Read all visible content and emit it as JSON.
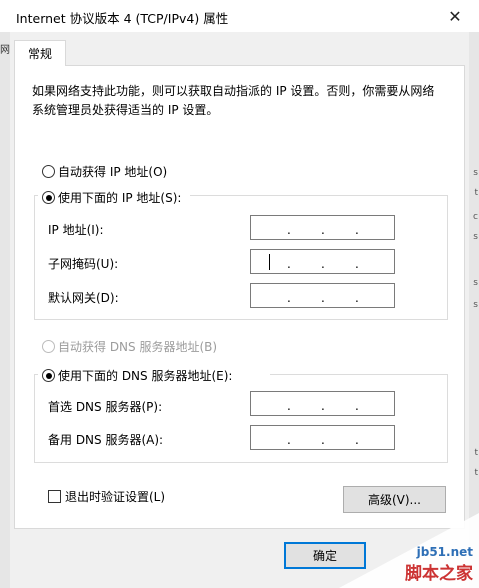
{
  "window": {
    "title": "Internet 协议版本 4 (TCP/IPv4) 属性",
    "close_glyph": "✕"
  },
  "background": {
    "left_text": "网",
    "right_marks": [
      "s",
      "t",
      "c",
      "s",
      "s",
      "s",
      "t",
      "t"
    ]
  },
  "tabs": [
    {
      "label": "常规"
    }
  ],
  "description": "如果网络支持此功能，则可以获取自动指派的 IP 设置。否则，你需要从网络系统管理员处获得适当的 IP 设置。",
  "ip_section": {
    "auto_label": "自动获得 IP 地址(O)",
    "auto_selected": false,
    "manual_label": "使用下面的 IP 地址(S):",
    "manual_selected": true,
    "fields": [
      {
        "label": "IP 地址(I):",
        "value": "   .   .   ."
      },
      {
        "label": "子网掩码(U):",
        "value": "   .   .   ."
      },
      {
        "label": "默认网关(D):",
        "value": "   .   .   ."
      }
    ]
  },
  "dns_section": {
    "auto_label": "自动获得 DNS 服务器地址(B)",
    "auto_selected": false,
    "auto_disabled": true,
    "manual_label": "使用下面的 DNS 服务器地址(E):",
    "manual_selected": true,
    "fields": [
      {
        "label": "首选 DNS 服务器(P):",
        "value": "   .   .   ."
      },
      {
        "label": "备用 DNS 服务器(A):",
        "value": "   .   .   ."
      }
    ]
  },
  "validate_label": "退出时验证设置(L)",
  "validate_checked": false,
  "advanced_label": "高级(V)...",
  "ok_label": "确定",
  "watermark": {
    "url": "jb51.net",
    "name": "脚本之家"
  },
  "dot": "."
}
